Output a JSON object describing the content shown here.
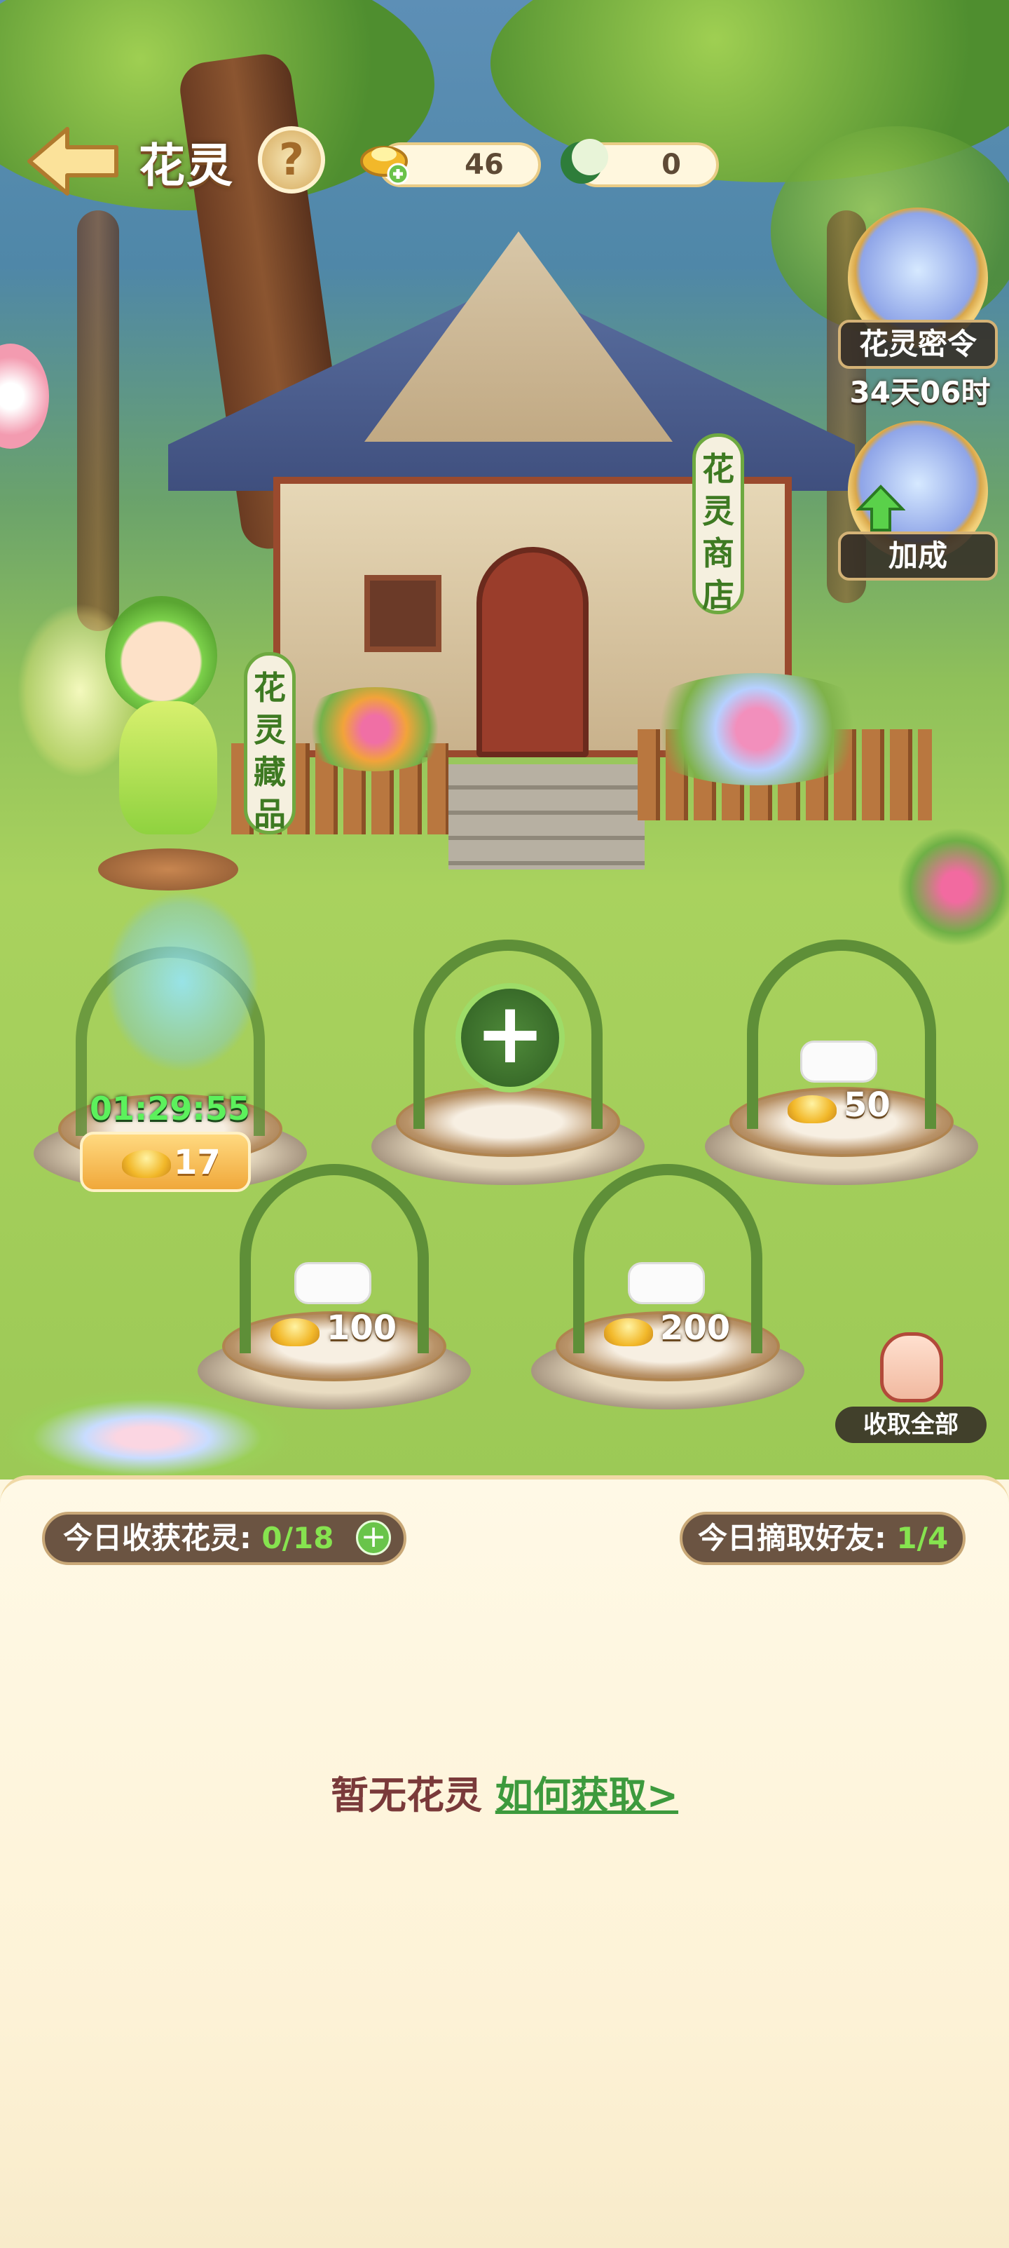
{
  "header": {
    "title": "花灵",
    "help_symbol": "?"
  },
  "currency": {
    "ingot_count": "46",
    "moon_count": "0"
  },
  "right_menu": {
    "secret_order_label": "花灵密令",
    "secret_order_countdown": "34天06时",
    "bonus_label": "加成"
  },
  "signs": {
    "shop": "花灵商店",
    "collection": "花灵藏品"
  },
  "slots": {
    "slot1": {
      "timer": "01:29:55",
      "speed_cost": "17"
    },
    "slot2": {
      "add_symbol": "+"
    },
    "slot3": {
      "price": "50"
    },
    "slot4": {
      "price": "100"
    },
    "slot5": {
      "price": "200"
    }
  },
  "collect_all_label": "收取全部",
  "panel": {
    "harvest_label": "今日收获花灵:",
    "harvest_value": "0/18",
    "pick_label": "今日摘取好友:",
    "pick_value": "1/4",
    "empty_text": "暂无花灵",
    "how_to_get": "如何获取>"
  },
  "colors": {
    "accent_green": "#3d9a3d",
    "title_brown": "#7a3a3a",
    "panel_bg": "#fdf6df"
  }
}
